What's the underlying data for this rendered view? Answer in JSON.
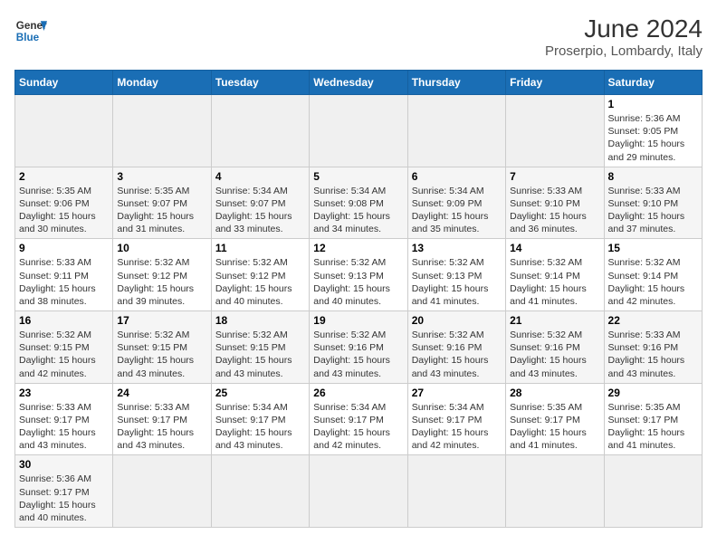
{
  "header": {
    "logo_general": "General",
    "logo_blue": "Blue",
    "title": "June 2024",
    "subtitle": "Proserpio, Lombardy, Italy"
  },
  "days_of_week": [
    "Sunday",
    "Monday",
    "Tuesday",
    "Wednesday",
    "Thursday",
    "Friday",
    "Saturday"
  ],
  "weeks": [
    [
      {
        "day": "",
        "info": ""
      },
      {
        "day": "",
        "info": ""
      },
      {
        "day": "",
        "info": ""
      },
      {
        "day": "",
        "info": ""
      },
      {
        "day": "",
        "info": ""
      },
      {
        "day": "",
        "info": ""
      },
      {
        "day": "1",
        "info": "Sunrise: 5:36 AM\nSunset: 9:05 PM\nDaylight: 15 hours and 29 minutes."
      }
    ],
    [
      {
        "day": "2",
        "info": "Sunrise: 5:35 AM\nSunset: 9:06 PM\nDaylight: 15 hours and 30 minutes."
      },
      {
        "day": "3",
        "info": "Sunrise: 5:35 AM\nSunset: 9:07 PM\nDaylight: 15 hours and 31 minutes."
      },
      {
        "day": "4",
        "info": "Sunrise: 5:34 AM\nSunset: 9:07 PM\nDaylight: 15 hours and 33 minutes."
      },
      {
        "day": "5",
        "info": "Sunrise: 5:34 AM\nSunset: 9:08 PM\nDaylight: 15 hours and 34 minutes."
      },
      {
        "day": "6",
        "info": "Sunrise: 5:34 AM\nSunset: 9:09 PM\nDaylight: 15 hours and 35 minutes."
      },
      {
        "day": "7",
        "info": "Sunrise: 5:33 AM\nSunset: 9:10 PM\nDaylight: 15 hours and 36 minutes."
      },
      {
        "day": "8",
        "info": "Sunrise: 5:33 AM\nSunset: 9:10 PM\nDaylight: 15 hours and 37 minutes."
      }
    ],
    [
      {
        "day": "9",
        "info": "Sunrise: 5:33 AM\nSunset: 9:11 PM\nDaylight: 15 hours and 38 minutes."
      },
      {
        "day": "10",
        "info": "Sunrise: 5:32 AM\nSunset: 9:12 PM\nDaylight: 15 hours and 39 minutes."
      },
      {
        "day": "11",
        "info": "Sunrise: 5:32 AM\nSunset: 9:12 PM\nDaylight: 15 hours and 40 minutes."
      },
      {
        "day": "12",
        "info": "Sunrise: 5:32 AM\nSunset: 9:13 PM\nDaylight: 15 hours and 40 minutes."
      },
      {
        "day": "13",
        "info": "Sunrise: 5:32 AM\nSunset: 9:13 PM\nDaylight: 15 hours and 41 minutes."
      },
      {
        "day": "14",
        "info": "Sunrise: 5:32 AM\nSunset: 9:14 PM\nDaylight: 15 hours and 41 minutes."
      },
      {
        "day": "15",
        "info": "Sunrise: 5:32 AM\nSunset: 9:14 PM\nDaylight: 15 hours and 42 minutes."
      }
    ],
    [
      {
        "day": "16",
        "info": "Sunrise: 5:32 AM\nSunset: 9:15 PM\nDaylight: 15 hours and 42 minutes."
      },
      {
        "day": "17",
        "info": "Sunrise: 5:32 AM\nSunset: 9:15 PM\nDaylight: 15 hours and 43 minutes."
      },
      {
        "day": "18",
        "info": "Sunrise: 5:32 AM\nSunset: 9:15 PM\nDaylight: 15 hours and 43 minutes."
      },
      {
        "day": "19",
        "info": "Sunrise: 5:32 AM\nSunset: 9:16 PM\nDaylight: 15 hours and 43 minutes."
      },
      {
        "day": "20",
        "info": "Sunrise: 5:32 AM\nSunset: 9:16 PM\nDaylight: 15 hours and 43 minutes."
      },
      {
        "day": "21",
        "info": "Sunrise: 5:32 AM\nSunset: 9:16 PM\nDaylight: 15 hours and 43 minutes."
      },
      {
        "day": "22",
        "info": "Sunrise: 5:33 AM\nSunset: 9:16 PM\nDaylight: 15 hours and 43 minutes."
      }
    ],
    [
      {
        "day": "23",
        "info": "Sunrise: 5:33 AM\nSunset: 9:17 PM\nDaylight: 15 hours and 43 minutes."
      },
      {
        "day": "24",
        "info": "Sunrise: 5:33 AM\nSunset: 9:17 PM\nDaylight: 15 hours and 43 minutes."
      },
      {
        "day": "25",
        "info": "Sunrise: 5:34 AM\nSunset: 9:17 PM\nDaylight: 15 hours and 43 minutes."
      },
      {
        "day": "26",
        "info": "Sunrise: 5:34 AM\nSunset: 9:17 PM\nDaylight: 15 hours and 42 minutes."
      },
      {
        "day": "27",
        "info": "Sunrise: 5:34 AM\nSunset: 9:17 PM\nDaylight: 15 hours and 42 minutes."
      },
      {
        "day": "28",
        "info": "Sunrise: 5:35 AM\nSunset: 9:17 PM\nDaylight: 15 hours and 41 minutes."
      },
      {
        "day": "29",
        "info": "Sunrise: 5:35 AM\nSunset: 9:17 PM\nDaylight: 15 hours and 41 minutes."
      }
    ],
    [
      {
        "day": "30",
        "info": "Sunrise: 5:36 AM\nSunset: 9:17 PM\nDaylight: 15 hours and 40 minutes."
      },
      {
        "day": "",
        "info": ""
      },
      {
        "day": "",
        "info": ""
      },
      {
        "day": "",
        "info": ""
      },
      {
        "day": "",
        "info": ""
      },
      {
        "day": "",
        "info": ""
      },
      {
        "day": "",
        "info": ""
      }
    ]
  ],
  "colors": {
    "header_bg": "#1a6eb5",
    "logo_blue": "#1a6eb5"
  }
}
